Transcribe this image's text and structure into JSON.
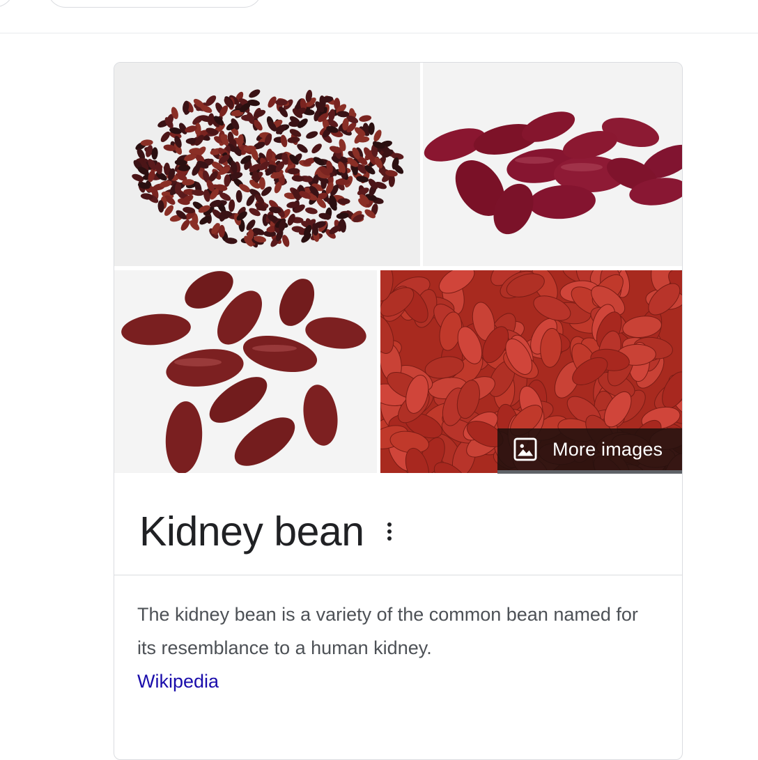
{
  "knowledge_panel": {
    "images": [
      {
        "name": "kidney-beans-pile-dark"
      },
      {
        "name": "kidney-beans-cluster"
      },
      {
        "name": "kidney-beans-scattered"
      },
      {
        "name": "kidney-beans-closeup"
      }
    ],
    "more_images_label": "More images",
    "more_images_icon": "image-icon",
    "title": "Kidney bean",
    "menu_icon": "more-vert-icon",
    "description": "The kidney bean is a variety of the common bean named for its resemblance to a human kidney.",
    "source_link": "Wikipedia",
    "colors": {
      "title": "#202124",
      "description": "#4d5156",
      "link": "#1a0dab",
      "border": "#dadce0",
      "bean_red": "#8e1d2c",
      "bean_dark": "#3a1215"
    }
  }
}
